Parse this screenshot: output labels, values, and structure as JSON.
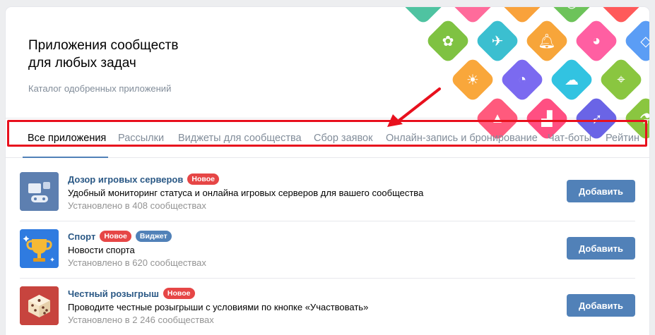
{
  "header": {
    "title_line1": "Приложения сообществ",
    "title_line2": "для любых задач",
    "subtitle": "Каталог одобренных приложений"
  },
  "tabs": [
    {
      "label": "Все приложения",
      "active": true
    },
    {
      "label": "Рассылки"
    },
    {
      "label": "Виджеты для сообщества"
    },
    {
      "label": "Сбор заявок"
    },
    {
      "label": "Онлайн-запись и бронирование"
    },
    {
      "label": "Чат-боты"
    },
    {
      "label": "Рейтин"
    }
  ],
  "apps": [
    {
      "name": "Дозор игровых серверов",
      "badges": [
        "Новое"
      ],
      "description": "Удобный мониторинг статуса и онлайна игровых серверов для вашего сообщества",
      "installed": "Установлено в 408 сообществах",
      "button": "Добавить",
      "icon": "server-monitor-icon"
    },
    {
      "name": "Спорт",
      "badges": [
        "Новое",
        "Виджет"
      ],
      "description": "Новости спорта",
      "installed": "Установлено в 620 сообществах",
      "button": "Добавить",
      "icon": "trophy-icon"
    },
    {
      "name": "Честный розыгрыш",
      "badges": [
        "Новое"
      ],
      "description": "Проводите честные розыгрыши с условиями по кнопке «Участвовать»",
      "installed": "Установлено в 2 246 сообществах",
      "button": "Добавить",
      "icon": "dice-icon"
    }
  ],
  "colors": {
    "accent": "#5181b8",
    "link": "#2a5885",
    "badge_new": "#e64646",
    "highlight": "#e8101d"
  }
}
